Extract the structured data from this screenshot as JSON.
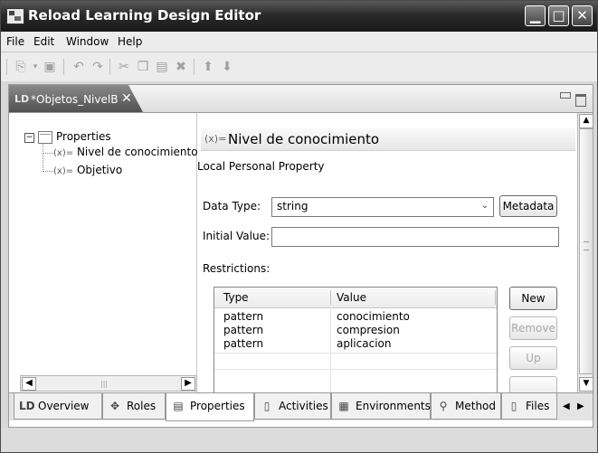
{
  "window": {
    "title": "Reload Learning Design Editor"
  },
  "menu": [
    "File",
    "Edit",
    "Window",
    "Help"
  ],
  "toolbar": {
    "icons": [
      "new-file-icon",
      "dropdown-arrow-icon",
      "save-icon",
      "undo-icon",
      "redo-icon",
      "cut-icon",
      "copy-icon",
      "paste-icon",
      "delete-icon",
      "move-up-icon",
      "move-down-icon"
    ]
  },
  "editor_tab": {
    "icon": "LD",
    "label": "*Objetos_NivelB"
  },
  "tree": {
    "root": "Properties",
    "children": [
      "Nivel de conocimiento",
      "Objetivo"
    ],
    "child_prefix": "(x)="
  },
  "detail": {
    "header_icon": "(x)=",
    "title": "Nivel de conocimiento",
    "subtitle": "Local Personal Property",
    "data_type_label": "Data Type:",
    "data_type_value": "string",
    "metadata_button": "Metadata",
    "initial_value_label": "Initial Value:",
    "initial_value": "",
    "restrictions_label": "Restrictions:",
    "table": {
      "columns": [
        "Type",
        "Value"
      ],
      "rows": [
        [
          "pattern",
          "conocimiento"
        ],
        [
          "pattern",
          "compresion"
        ],
        [
          "pattern",
          "aplicacion"
        ]
      ]
    },
    "buttons": {
      "new": "New",
      "remove": "Remove",
      "up": "Up"
    }
  },
  "bottom_tabs": {
    "items": [
      {
        "icon": "LD",
        "label": "Overview",
        "active": false
      },
      {
        "icon": "roles-icon",
        "label": "Roles",
        "active": false
      },
      {
        "icon": "properties-icon",
        "label": "Properties",
        "active": true
      },
      {
        "icon": "activities-icon",
        "label": "Activities",
        "active": false
      },
      {
        "icon": "environments-icon",
        "label": "Environments",
        "active": false
      },
      {
        "icon": "method-icon",
        "label": "Method",
        "active": false
      },
      {
        "icon": "files-icon",
        "label": "Files",
        "active": false
      }
    ]
  }
}
